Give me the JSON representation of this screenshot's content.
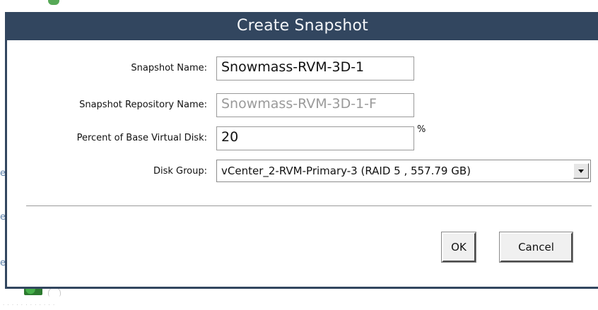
{
  "dialog": {
    "title": "Create Snapshot",
    "fields": {
      "snapshot_name": {
        "label": "Snapshot Name:",
        "value": "Snowmass-RVM-3D-1"
      },
      "repository_name": {
        "label": "Snapshot Repository Name:",
        "value": "Snowmass-RVM-3D-1-F"
      },
      "percent": {
        "label": "Percent of Base Virtual Disk:",
        "value": "20",
        "unit": "%"
      },
      "disk_group": {
        "label": "Disk Group:",
        "selected": "vCenter_2-RVM-Primary-3 (RAID 5 , 557.79 GB)"
      }
    },
    "buttons": {
      "ok": "OK",
      "cancel": "Cancel"
    }
  },
  "background": {
    "edge_marks": [
      "e",
      "e",
      "e"
    ],
    "bottom_dots": "· · · · · · · · · · · ·"
  },
  "colors": {
    "titlebar": "#32465f",
    "title_text": "#f4f6f9",
    "disabled_text": "#9a9a9a"
  }
}
